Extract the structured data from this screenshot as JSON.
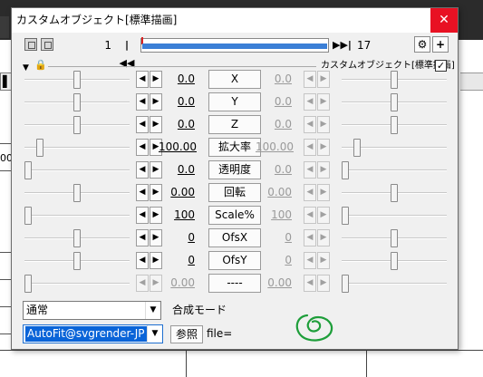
{
  "window": {
    "title": "カスタムオブジェクト[標準描画]",
    "close_glyph": "✕"
  },
  "frame_toolbar": {
    "start_frame": "1",
    "end_frame": "17",
    "prev_glyph": "|◀◀",
    "next_glyph": "▶▶|",
    "add_glyph": "+"
  },
  "section": {
    "collapse_glyph": "▼",
    "lock_glyph": "🔒",
    "label": "カスタムオブジェクト[標準描画]",
    "checked": true,
    "check_glyph": "✓"
  },
  "spin_glyphs": {
    "left": "◀",
    "right": "▶"
  },
  "params": [
    {
      "name": "X",
      "start": "0.0",
      "end": "0.0",
      "dim": false,
      "start_level": 0.5,
      "end_level": 0.5
    },
    {
      "name": "Y",
      "start": "0.0",
      "end": "0.0",
      "dim": false,
      "start_level": 0.5,
      "end_level": 0.5
    },
    {
      "name": "Z",
      "start": "0.0",
      "end": "0.0",
      "dim": false,
      "start_level": 0.5,
      "end_level": 0.5
    },
    {
      "name": "拡大率",
      "start": "100.00",
      "end": "100.00",
      "dim": false,
      "start_level": 0.12,
      "end_level": 0.12
    },
    {
      "name": "透明度",
      "start": "0.0",
      "end": "0.0",
      "dim": false,
      "start_level": 0.0,
      "end_level": 0.0
    },
    {
      "name": "回転",
      "start": "0.00",
      "end": "0.00",
      "dim": false,
      "start_level": 0.5,
      "end_level": 0.5
    },
    {
      "name": "Scale%",
      "start": "100",
      "end": "100",
      "dim": false,
      "start_level": 0.0,
      "end_level": 0.0
    },
    {
      "name": "OfsX",
      "start": "0",
      "end": "0",
      "dim": false,
      "start_level": 0.5,
      "end_level": 0.5
    },
    {
      "name": "OfsY",
      "start": "0",
      "end": "0",
      "dim": false,
      "start_level": 0.5,
      "end_level": 0.5
    },
    {
      "name": "----",
      "start": "0.00",
      "end": "0.00",
      "dim": true,
      "start_level": 0.0,
      "end_level": 0.0
    }
  ],
  "blend": {
    "value": "通常",
    "label": "合成モード",
    "arrow_glyph": "▼"
  },
  "script": {
    "value": "AutoFit@svgrender-JP",
    "browse_label": "参照",
    "file_label": "file=",
    "arrow_glyph": "▼"
  },
  "background": {
    "left_text": "00:"
  },
  "colors": {
    "accent": "#0a64d8",
    "timeline_fill": "#3b7fd6",
    "close_bg": "#e81123",
    "scribble": "#1e9e3a"
  }
}
